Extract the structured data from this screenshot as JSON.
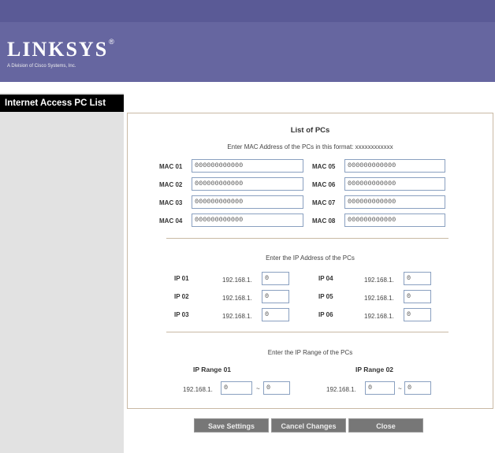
{
  "brand": {
    "name": "LINKSYS",
    "reg": "®",
    "subtitle": "A Division of Cisco Systems, Inc."
  },
  "sidebar": {
    "title": "Internet Access PC List"
  },
  "panel": {
    "title": "List of PCs",
    "mac_instruction": "Enter MAC Address of the PCs in this format: xxxxxxxxxxxx",
    "mac_fields": [
      {
        "label": "MAC 01",
        "value": "000000000000"
      },
      {
        "label": "MAC 02",
        "value": "000000000000"
      },
      {
        "label": "MAC 03",
        "value": "000000000000"
      },
      {
        "label": "MAC 04",
        "value": "000000000000"
      },
      {
        "label": "MAC 05",
        "value": "000000000000"
      },
      {
        "label": "MAC 06",
        "value": "000000000000"
      },
      {
        "label": "MAC 07",
        "value": "000000000000"
      },
      {
        "label": "MAC 08",
        "value": "000000000000"
      }
    ],
    "ip_instruction": "Enter the IP Address of the PCs",
    "ip_prefix": "192.168.1.",
    "ip_fields": [
      {
        "label": "IP 01",
        "value": "0"
      },
      {
        "label": "IP 02",
        "value": "0"
      },
      {
        "label": "IP 03",
        "value": "0"
      },
      {
        "label": "IP 04",
        "value": "0"
      },
      {
        "label": "IP 05",
        "value": "0"
      },
      {
        "label": "IP 06",
        "value": "0"
      }
    ],
    "range_instruction": "Enter the IP Range of the PCs",
    "ranges": [
      {
        "label": "IP Range 01",
        "prefix": "192.168.1.",
        "start": "0",
        "dash": "~",
        "end": "0"
      },
      {
        "label": "IP Range 02",
        "prefix": "192.168.1.",
        "start": "0",
        "dash": "~",
        "end": "0"
      }
    ]
  },
  "buttons": {
    "save": "Save Settings",
    "cancel": "Cancel Changes",
    "close": "Close"
  },
  "colors": {
    "header": "#6666a0",
    "sidebar": "#e2e2e2",
    "sidebar_title": "#000000",
    "panel_border": "#c9b9a4",
    "button": "#777777"
  }
}
